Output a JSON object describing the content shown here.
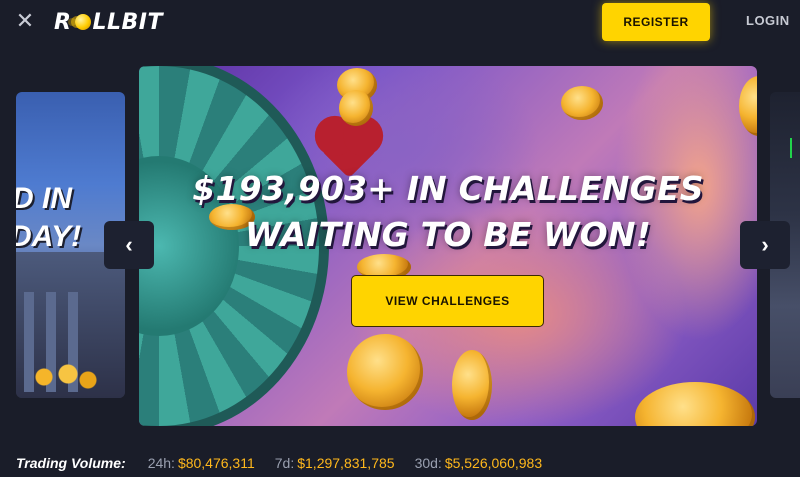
{
  "header": {
    "close_icon": "close-icon",
    "logo_text_a": "R",
    "logo_text_b": "LLBIT",
    "register_label": "REGISTER",
    "login_label": "LOGIN"
  },
  "carousel": {
    "left_card": {
      "line1": "D IN",
      "line2": "DAY!"
    },
    "banner": {
      "headline_line1": "$193,903+ IN CHALLENGES",
      "headline_line2": "WAITING TO BE WON!",
      "cta_label": "VIEW CHALLENGES"
    },
    "prev_icon": "chevron-left-icon",
    "next_icon": "chevron-right-icon"
  },
  "stats": {
    "label": "Trading Volume:",
    "items": [
      {
        "period": "24h:",
        "value": "$80,476,311"
      },
      {
        "period": "7d:",
        "value": "$1,297,831,785"
      },
      {
        "period": "30d:",
        "value": "$5,526,060,983"
      }
    ]
  },
  "colors": {
    "background": "#1a1d29",
    "accent_yellow": "#ffd400",
    "stat_value": "#ffb81c"
  }
}
